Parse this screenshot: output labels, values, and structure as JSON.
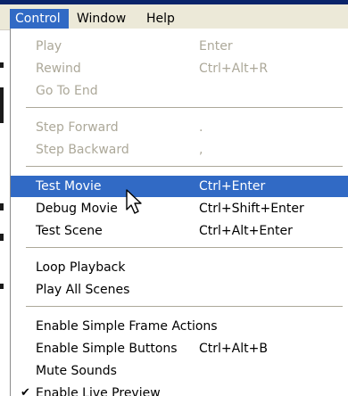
{
  "menubar": {
    "items": [
      {
        "label": "Control",
        "active": true
      },
      {
        "label": "Window",
        "active": false
      },
      {
        "label": "Help",
        "active": false
      }
    ]
  },
  "menu": {
    "groups": [
      [
        {
          "label": "Play",
          "shortcut": "Enter",
          "enabled": false
        },
        {
          "label": "Rewind",
          "shortcut": "Ctrl+Alt+R",
          "enabled": false
        },
        {
          "label": "Go To End",
          "shortcut": "",
          "enabled": false
        }
      ],
      [
        {
          "label": "Step Forward",
          "shortcut": ".",
          "enabled": false
        },
        {
          "label": "Step Backward",
          "shortcut": ",",
          "enabled": false
        }
      ],
      [
        {
          "label": "Test Movie",
          "shortcut": "Ctrl+Enter",
          "enabled": true,
          "highlighted": true
        },
        {
          "label": "Debug Movie",
          "shortcut": "Ctrl+Shift+Enter",
          "enabled": true
        },
        {
          "label": "Test Scene",
          "shortcut": "Ctrl+Alt+Enter",
          "enabled": true
        }
      ],
      [
        {
          "label": "Loop Playback",
          "shortcut": "",
          "enabled": true
        },
        {
          "label": "Play All Scenes",
          "shortcut": "",
          "enabled": true
        }
      ],
      [
        {
          "label": "Enable Simple Frame Actions",
          "shortcut": "",
          "enabled": true
        },
        {
          "label": "Enable Simple Buttons",
          "shortcut": "Ctrl+Alt+B",
          "enabled": true
        },
        {
          "label": "Mute Sounds",
          "shortcut": "",
          "enabled": true
        },
        {
          "label": "Enable Live Preview",
          "shortcut": "",
          "enabled": true,
          "checked": true
        }
      ]
    ]
  },
  "colors": {
    "highlight": "#316ac5",
    "disabled_text": "#aca899",
    "menubar_bg": "#ece9d8"
  },
  "icons": {
    "check": "check-icon",
    "cursor": "arrow-cursor-icon"
  }
}
